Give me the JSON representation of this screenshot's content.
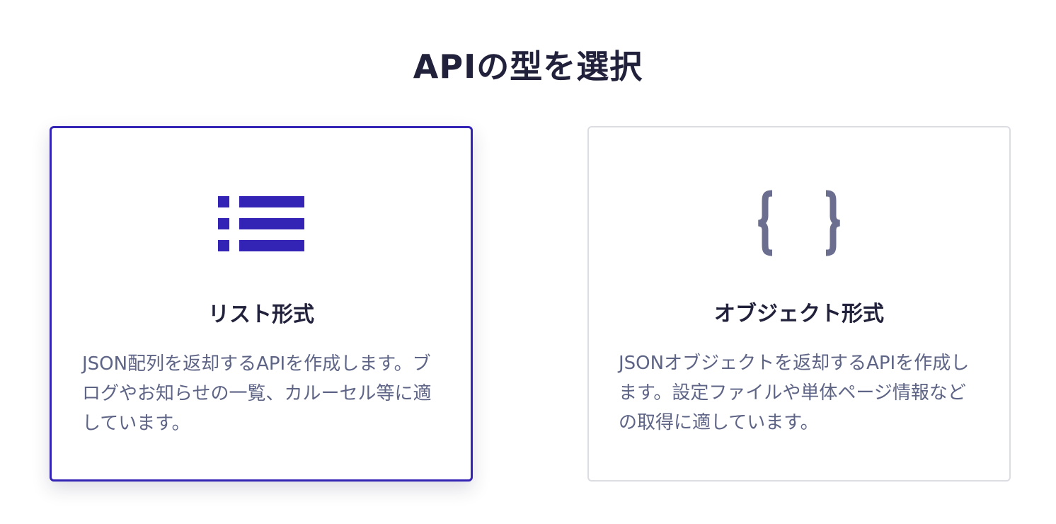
{
  "page": {
    "title": "APIの型を選択"
  },
  "options": [
    {
      "icon": "list-icon",
      "title": "リスト形式",
      "description": "JSON配列を返却するAPIを作成します。ブログやお知らせの一覧、カルーセル等に適しています。",
      "selected": true
    },
    {
      "icon": "curly-braces-icon",
      "title": "オブジェクト形式",
      "description": "JSONオブジェクトを返却するAPIを作成します。設定ファイルや単体ページ情報などの取得に適しています。",
      "selected": false
    }
  ],
  "colors": {
    "accent": "#3424b5",
    "icon_muted": "#6b6e8f",
    "title_text": "#21213b",
    "body_text": "#5e6485",
    "card_border": "#dcdce3"
  }
}
